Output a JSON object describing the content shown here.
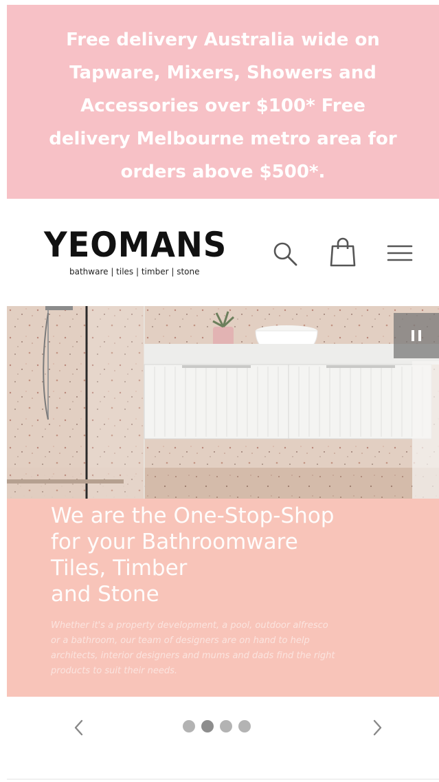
{
  "announcement": {
    "lines": [
      "Free delivery Australia wide on",
      "Tapware, Mixers, Showers and",
      "Accessories over $100* Free",
      "delivery Melbourne metro area for",
      "orders above $500*."
    ]
  },
  "header": {
    "logo_text": "YEOMANS",
    "logo_tagline": "bathware | tiles | timber | stone",
    "icons": [
      "search-icon",
      "cart-icon",
      "menu-icon"
    ]
  },
  "slideshow": {
    "heading_lines": [
      "We are the One-Stop-Shop",
      "for your Bathroomware",
      "Tiles, Timber",
      "and Stone"
    ],
    "body_lines": [
      "Whether it's a property development, a pool, outdoor alfresco",
      "or a bathroom, our team of designers are on hand to help",
      "architects, interior designers and mums and dads find the right",
      "products to suit their needs."
    ],
    "slide_count": 4,
    "active_slide": 2
  },
  "colors": {
    "announcement_bg": "#f7c1c6",
    "slide_text_bg": "#f8c4b9",
    "dot": "#b3b3b3",
    "dot_active": "#8d8d8d"
  }
}
